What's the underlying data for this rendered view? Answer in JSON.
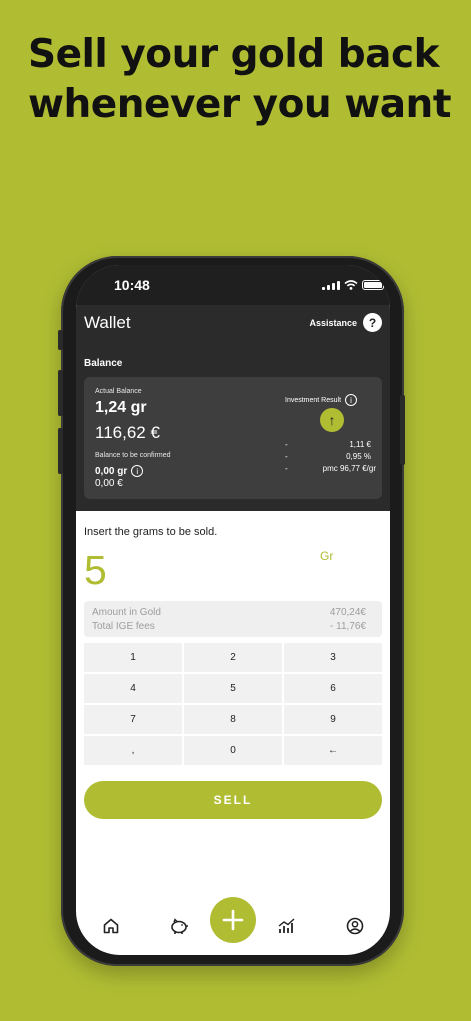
{
  "headline": {
    "line1": "Sell your gold back",
    "line2": "whenever you want"
  },
  "status_bar": {
    "time": "10:48"
  },
  "header": {
    "title": "Wallet",
    "assistance_label": "Assistance",
    "help_icon": "?"
  },
  "balance": {
    "section_title": "Balance",
    "actual_label": "Actual Balance",
    "actual_grams": "1,24 gr",
    "actual_euro": "116,62 €",
    "to_confirm_label": "Balance to be confirmed",
    "to_confirm_grams": "0,00 gr",
    "to_confirm_euro": "0,00 €",
    "investment_label": "Investment Result",
    "investment_rows": [
      {
        "dash": "-",
        "value": "1,11 €"
      },
      {
        "dash": "-",
        "value": "0,95 %"
      },
      {
        "dash": "-",
        "value": "pmc 96,77 €/gr"
      }
    ]
  },
  "sell_form": {
    "instruction": "Insert the grams to be sold.",
    "amount": "5",
    "unit": "Gr",
    "amount_in_gold_label": "Amount in Gold",
    "amount_in_gold_value": "470,24€",
    "fees_label": "Total IGE fees",
    "fees_value": "- 11,76€"
  },
  "keypad": {
    "keys": [
      "1",
      "2",
      "3",
      "4",
      "5",
      "6",
      "7",
      "8",
      "9",
      ",",
      "0",
      "←"
    ]
  },
  "sell_button": "SELL",
  "tabbar": {
    "items": [
      "home-icon",
      "piggy-bank-icon",
      "plus-icon",
      "chart-icon",
      "user-icon"
    ]
  },
  "colors": {
    "accent": "#b0bd33",
    "dark": "#2b2b2b",
    "card": "#3e3e3e"
  }
}
